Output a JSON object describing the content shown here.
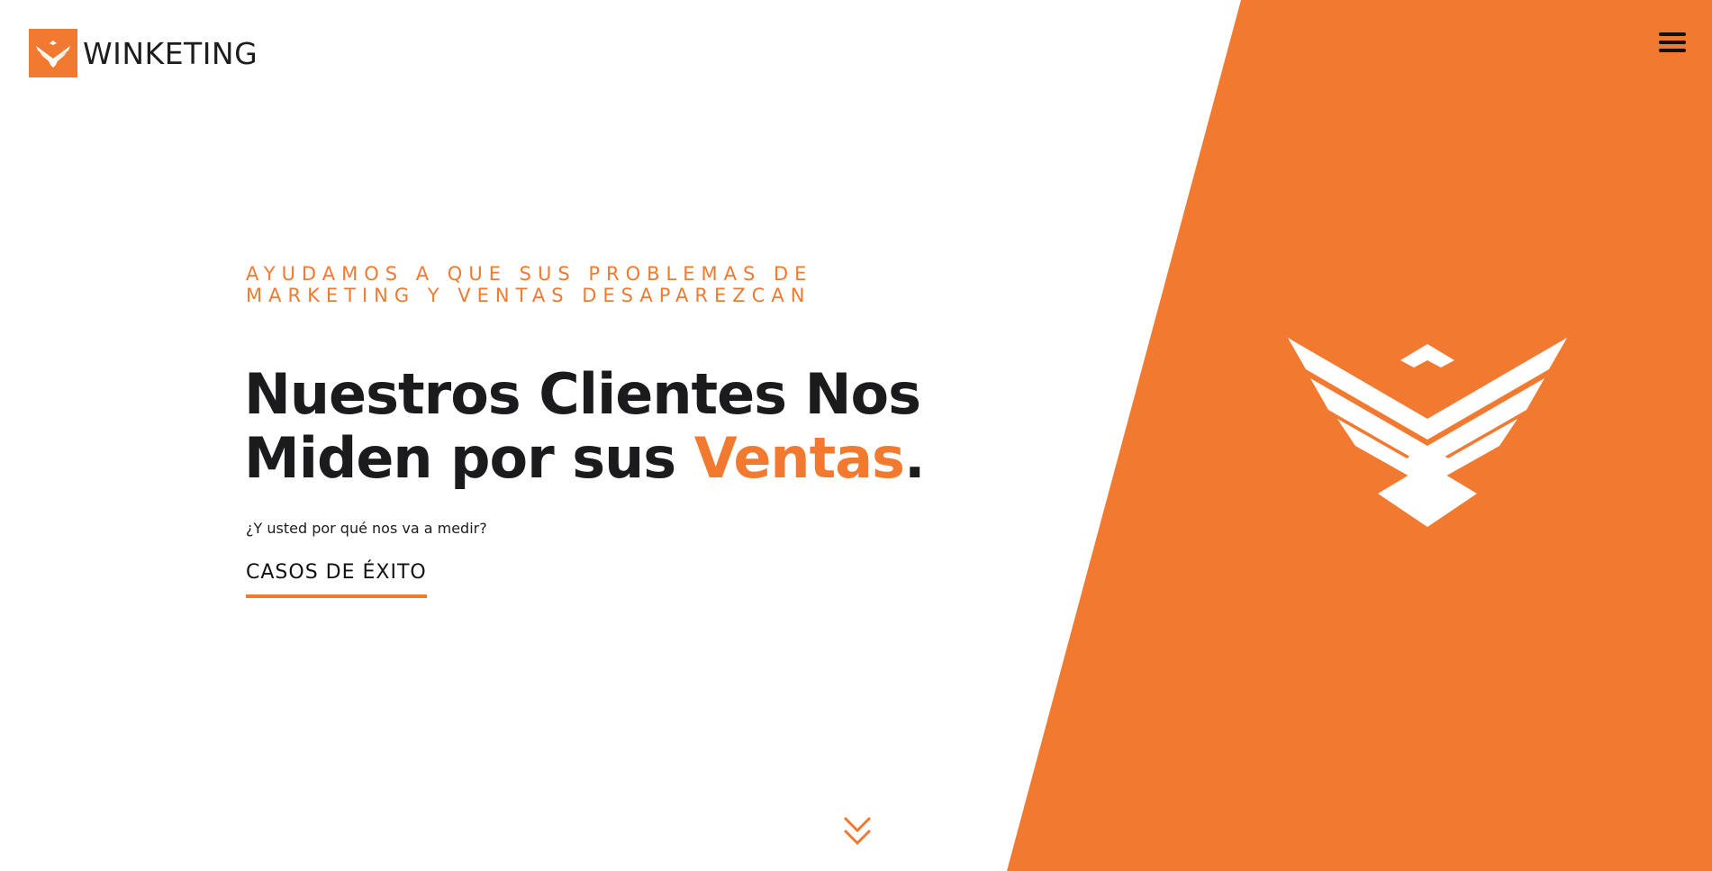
{
  "colors": {
    "accent": "#f27a30",
    "text_dark": "#1b1b1d",
    "background": "#ffffff"
  },
  "header": {
    "brand_name": "WINKETING",
    "logo_icon": "eagle-logo-icon",
    "menu_icon": "hamburger-menu-icon"
  },
  "hero": {
    "eyebrow_line1": "AYUDAMOS A QUE SUS PROBLEMAS DE",
    "eyebrow_line2": "MARKETING Y VENTAS DESAPAREZCAN",
    "headline_line1": "Nuestros Clientes Nos",
    "headline_line2_prefix": "Miden por sus ",
    "headline_highlight": "Ventas",
    "headline_period": ".",
    "subtext": "¿Y usted por qué nos va a medir?",
    "cta_label": "CASOS DE ÉXITO",
    "scroll_icon": "double-chevron-down-icon"
  },
  "side_panel": {
    "emblem_icon": "eagle-emblem-icon"
  }
}
